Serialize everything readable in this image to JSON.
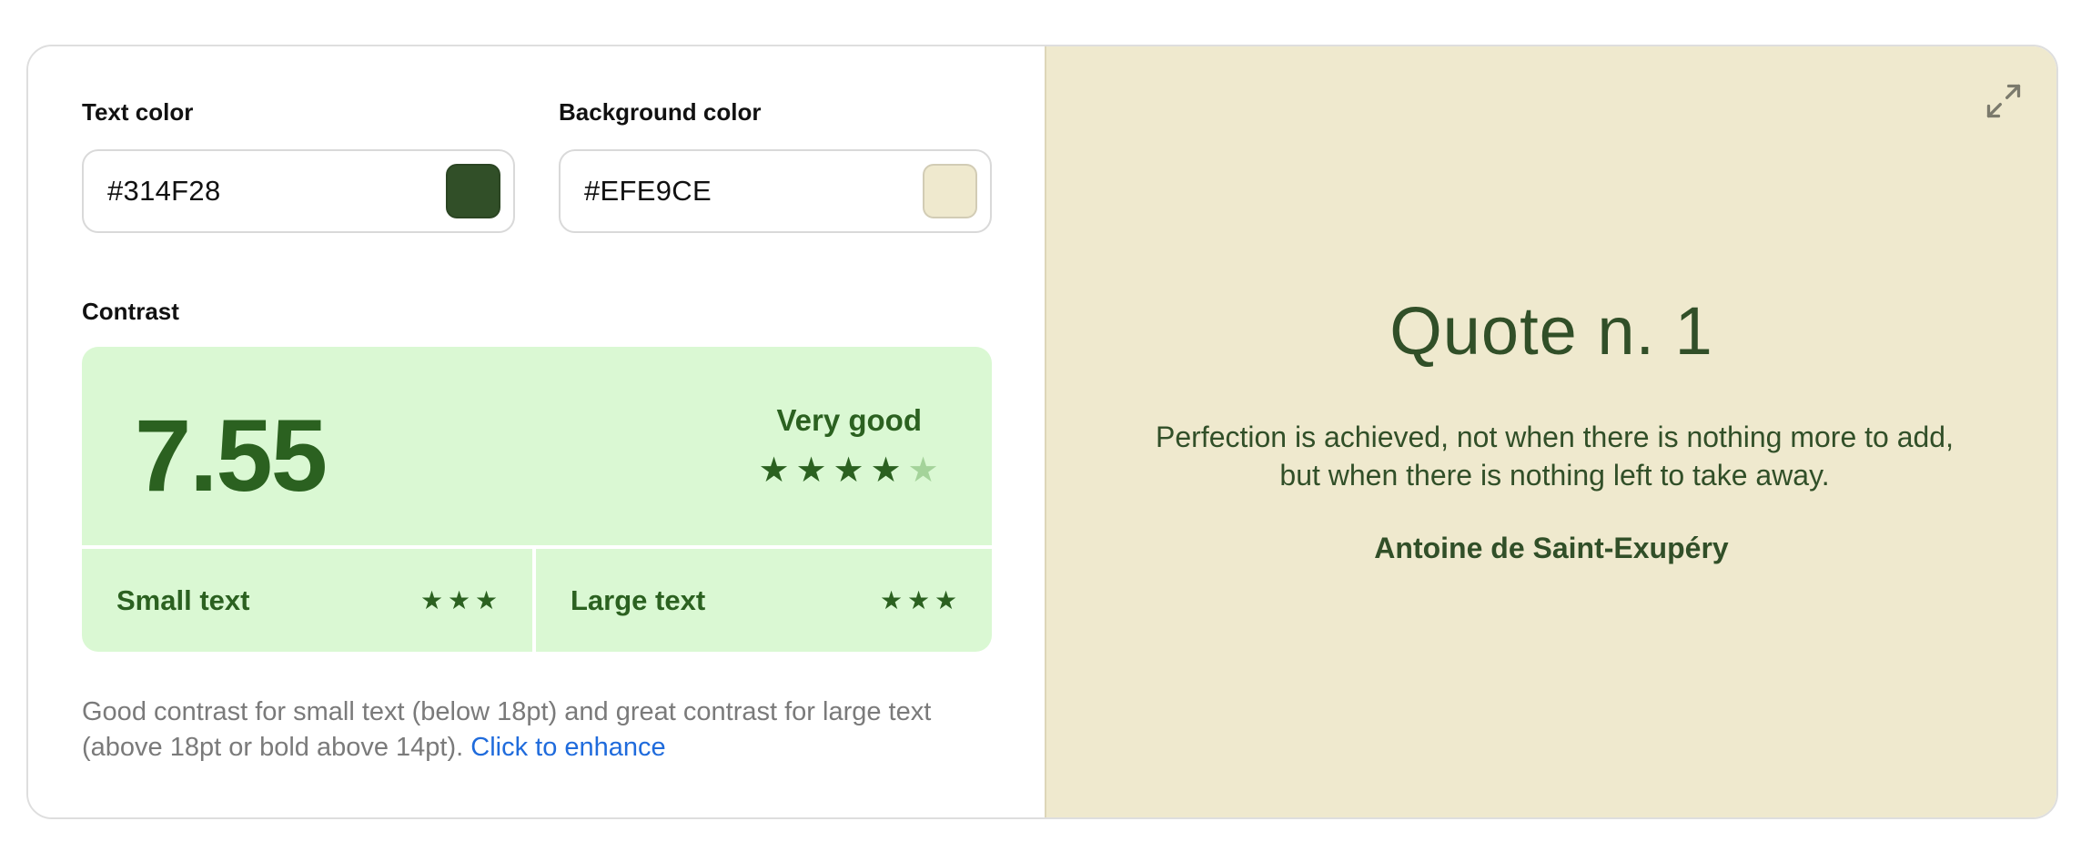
{
  "text_color": {
    "label": "Text color",
    "value": "#314F28",
    "swatch": "#314F28"
  },
  "background_color": {
    "label": "Background color",
    "value": "#EFE9CE",
    "swatch": "#EFE9CE"
  },
  "contrast": {
    "label": "Contrast",
    "ratio": "7.55",
    "rating": "Very good",
    "stars": 4,
    "stars_max": 5,
    "small_text": {
      "label": "Small text",
      "stars": 3
    },
    "large_text": {
      "label": "Large text",
      "stars": 3
    },
    "colors": {
      "box": "#DAF8D3",
      "accent": "#2B6120",
      "star_off": "#A4D39A"
    }
  },
  "description": {
    "text": "Good contrast for small text (below 18pt) and great contrast for large text (above 18pt or bold above 14pt).",
    "link": "Click to enhance"
  },
  "preview": {
    "title": "Quote n. 1",
    "quote": "Perfection is achieved, not when there is nothing more to add, but when there is nothing left to take away.",
    "author": "Antoine de Saint-Exupéry",
    "expand_icon": "expand-icon"
  }
}
